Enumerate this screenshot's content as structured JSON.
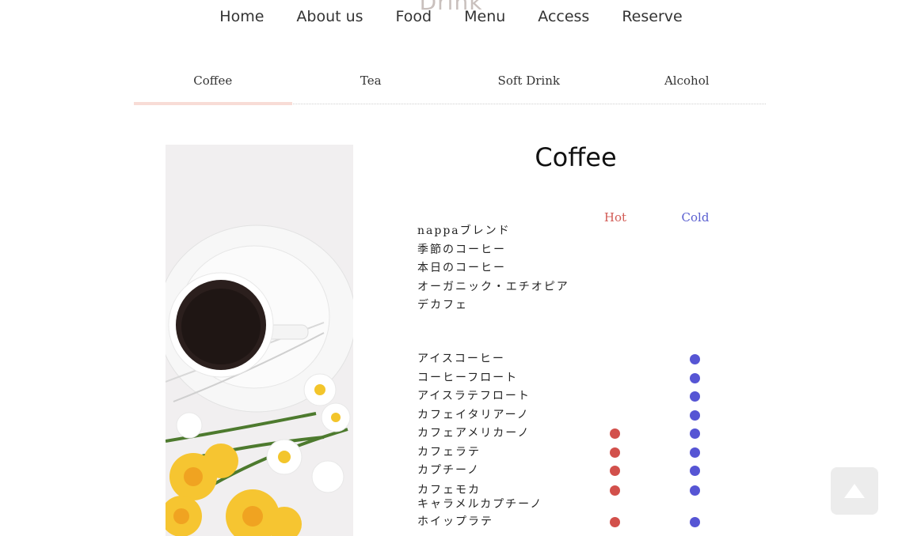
{
  "nav": {
    "faded_title": "Drink",
    "items": [
      "Home",
      "About us",
      "Food",
      "Menu",
      "Access",
      "Reserve"
    ]
  },
  "tabs": [
    "Coffee",
    "Tea",
    "Soft Drink",
    "Alcohol"
  ],
  "active_tab": "Coffee",
  "section": {
    "title": "Coffee",
    "hot_label": "Hot",
    "cold_label": "Cold"
  },
  "hot_items": [
    "nappaブレンド",
    "季節のコーヒー",
    "本日のコーヒー",
    "オーガニック・エチオピア",
    "デカフェ"
  ],
  "drinks": [
    {
      "name": "アイスコーヒー",
      "hot": false,
      "cold": true
    },
    {
      "name": "コーヒーフロート",
      "hot": false,
      "cold": true
    },
    {
      "name": "アイスラテフロート",
      "hot": false,
      "cold": true
    },
    {
      "name": "カフェイタリアーノ",
      "hot": false,
      "cold": true
    },
    {
      "name": "カフェアメリカーノ",
      "hot": true,
      "cold": true
    },
    {
      "name": "カフェラテ",
      "hot": true,
      "cold": true
    },
    {
      "name": "カプチーノ",
      "hot": true,
      "cold": true
    },
    {
      "name": "カフェモカ",
      "name2": "キャラメルカプチーノ",
      "hot": true,
      "cold": true
    },
    {
      "name": "ホイップラテ",
      "hot": true,
      "cold": true
    }
  ],
  "colors": {
    "hot": "#d2504b",
    "cold": "#5655d4",
    "active_tab_underline": "#f8dcd6"
  },
  "icons": {
    "back_to_top": "triangle-up-icon"
  }
}
